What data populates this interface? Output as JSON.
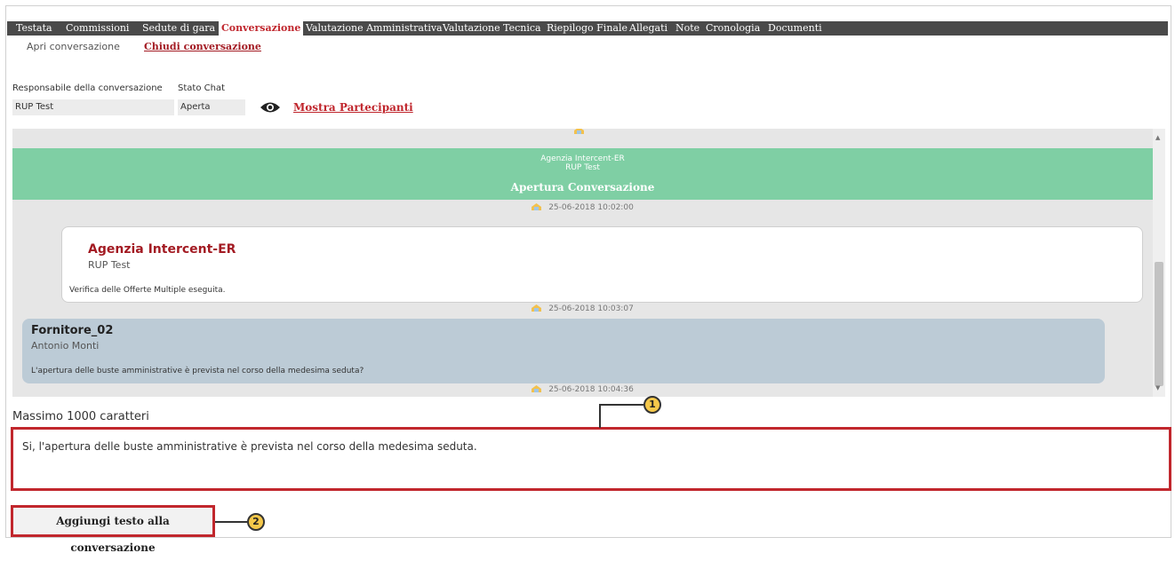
{
  "tabs": [
    {
      "label": "Testata",
      "active": false
    },
    {
      "label": "Commissioni",
      "active": false
    },
    {
      "label": "Sedute di gara",
      "active": false
    },
    {
      "label": "Conversazione",
      "active": true
    },
    {
      "label": "Valutazione Amministrativa",
      "active": false
    },
    {
      "label": "Valutazione Tecnica",
      "active": false
    },
    {
      "label": "Riepilogo Finale",
      "active": false
    },
    {
      "label": "Allegati",
      "active": false
    },
    {
      "label": "Note",
      "active": false
    },
    {
      "label": "Cronologia",
      "active": false
    },
    {
      "label": "Documenti",
      "active": false
    }
  ],
  "subnav": {
    "open": "Apri conversazione",
    "close": "Chiudi conversazione"
  },
  "fields": {
    "owner_label": "Responsabile della conversazione",
    "owner_value": "RUP Test",
    "status_label": "Stato Chat",
    "status_value": "Aperta",
    "participants_link": "Mostra Partecipanti"
  },
  "chat": {
    "banner": {
      "org": "Agenzia Intercent-ER",
      "user": "RUP Test",
      "title": "Apertura Conversazione"
    },
    "timestamps": [
      "25-06-2018 10:02:00",
      "25-06-2018 10:03:07",
      "25-06-2018 10:04:36"
    ],
    "messages": [
      {
        "org": "Agenzia Intercent-ER",
        "user": "RUP Test",
        "text": "Verifica delle Offerte Multiple eseguita."
      },
      {
        "org": "Fornitore_02",
        "user": "Antonio Monti",
        "text": "L'apertura delle buste amministrative è prevista nel corso della medesima seduta?"
      }
    ]
  },
  "input": {
    "max_label": "Massimo 1000 caratteri",
    "value": "Si, l'apertura delle buste amministrative è prevista nel corso della medesima seduta."
  },
  "submit_label": "Aggiungi testo alla conversazione",
  "callouts": [
    "1",
    "2"
  ],
  "colors": {
    "accent_red": "#c0262d",
    "banner_green": "#7fcfa4",
    "bubble_blue": "#bccbd6",
    "tabbar": "#4a4a4a"
  }
}
